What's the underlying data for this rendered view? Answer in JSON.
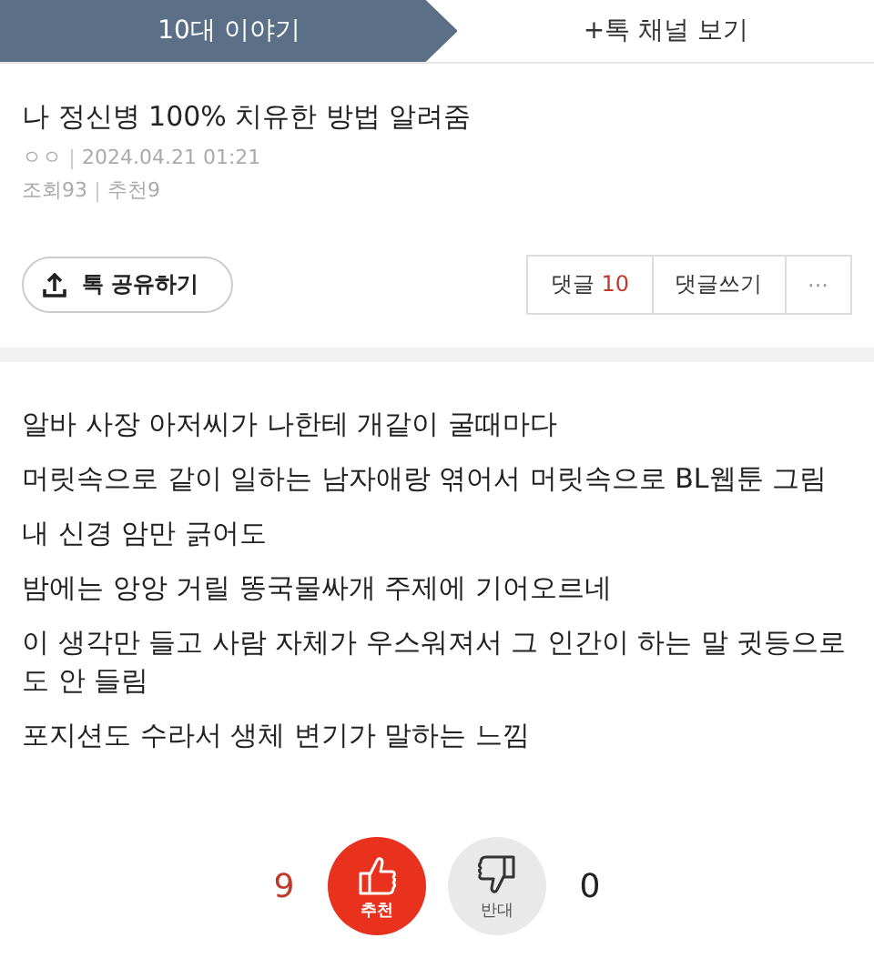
{
  "tabs": [
    {
      "label": "10대 이야기",
      "selected": true
    },
    {
      "label": "+톡 채널 보기",
      "selected": false
    }
  ],
  "post": {
    "title": "나 정신병 100% 치유한 방법 알려줌",
    "author": "ㅇㅇ",
    "date": "2024.04.21 01:21",
    "views": "조회93",
    "recommends": "추천9"
  },
  "share_button": "톡 공유하기",
  "comment_buttons": {
    "comments_label": "댓글",
    "comments_count": "10",
    "write": "댓글쓰기",
    "more": "···"
  },
  "body": [
    "알바 사장 아저씨가 나한테 개같이 굴때마다",
    "머릿속으로 같이 일하는 남자애랑 엮어서 머릿속으로 BL웹툰 그림",
    "내 신경 암만 긁어도",
    "밤에는 앙앙 거릴 똥국물싸개 주제에 기어오르네",
    "이 생각만 들고 사람 자체가 우스워져서 그 인간이 하는 말 귓등으로 도 안 들림",
    "포지션도 수라서 생체 변기가 말하는 느낌"
  ],
  "votes": [
    {
      "kind": "up",
      "count": "9",
      "label": "추천",
      "selected": true
    },
    {
      "kind": "down",
      "count": "0",
      "label": "반대",
      "selected": false
    }
  ]
}
